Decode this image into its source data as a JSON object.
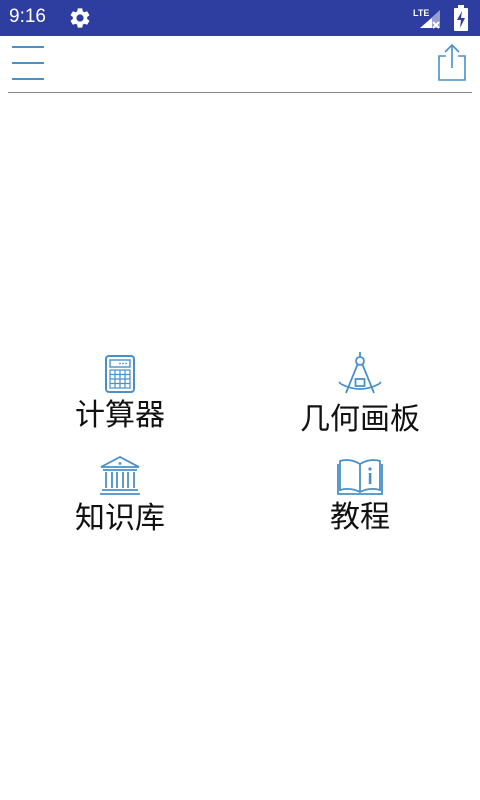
{
  "status_bar": {
    "time": "9:16",
    "network": "LTE",
    "icons": [
      "gear-icon",
      "signal-icon",
      "battery-charging-icon"
    ],
    "background_color": "#2d3da0"
  },
  "toolbar": {
    "menu_icon": "hamburger-menu-icon",
    "share_icon": "share-icon",
    "accent_color": "#4a90c8"
  },
  "tiles": [
    {
      "label": "计算器",
      "icon": "calculator-icon"
    },
    {
      "label": "几何画板",
      "icon": "compass-icon"
    },
    {
      "label": "知识库",
      "icon": "library-building-icon"
    },
    {
      "label": "教程",
      "icon": "info-book-icon"
    }
  ]
}
